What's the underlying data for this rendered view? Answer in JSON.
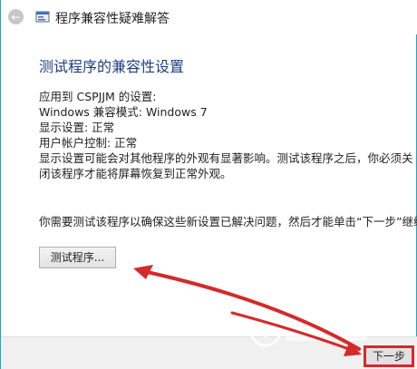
{
  "window": {
    "title": "程序兼容性疑难解答"
  },
  "main": {
    "heading": "测试程序的兼容性设置",
    "applied_to": "应用到  CSPJJM 的设置:",
    "compat_mode": "Windows 兼容模式: Windows 7",
    "display_setting": "显示设置:  正常",
    "uac": "用户帐户控制:  正常",
    "warning": "显示设置可能会对其他程序的外观有显著影响。测试该程序之后，你必须关闭该程序才能将屏幕恢复到正常外观。",
    "instruction": "你需要测试该程序以确保这些新设置已解决问题，然后才能单击“下一步”继续。",
    "test_button": "测试程序..."
  },
  "footer": {
    "next_button": "下一步"
  },
  "annotations": {
    "arrow_color": "#d42a2a"
  }
}
